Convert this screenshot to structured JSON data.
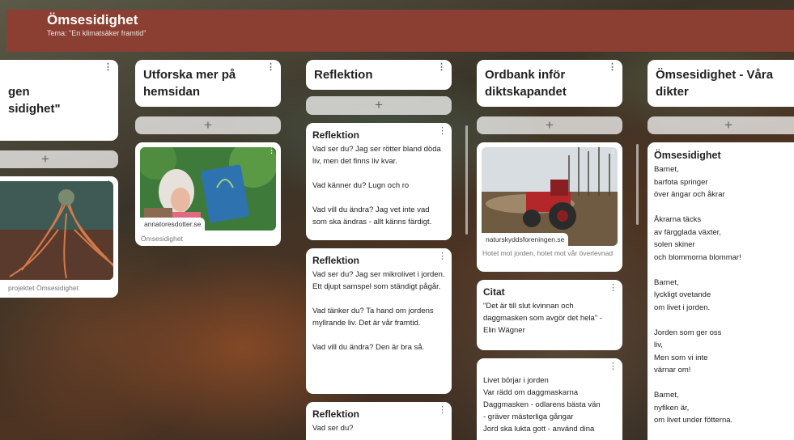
{
  "header": {
    "title": "Ömsesidighet",
    "subtitle": "Tema: \"En klimatsäker framtid\""
  },
  "columns": [
    {
      "title": "gen\nsidighet\"",
      "add_label": "+",
      "cards": [
        {
          "caption": "projektet Ömsesidighet",
          "image_icon": "roots-artwork-image"
        }
      ]
    },
    {
      "title": "Utforska mer på hemsidan",
      "add_label": "+",
      "cards": [
        {
          "link_label": "annatoresdotter.se",
          "caption": "Ömsesidighet",
          "image_icon": "woman-painting-photo"
        }
      ]
    },
    {
      "title": "Reflektion",
      "add_label": "+",
      "cards": [
        {
          "title": "Reflektion",
          "body": "Vad ser du? Jag ser rötter bland döda liv, men det finns liv kvar.\n\nVad känner du? Lugn och ro\n\nVad vill du ändra? Jag vet inte vad som ska ändras - allt känns färdigt."
        },
        {
          "title": "Reflektion",
          "body": "Vad ser du? Jag ser mikrolivet i jorden. Ett djupt samspel som ständigt pågår.\n\nVad tänker du? Ta hand om jordens myllrande liv. Det är vår framtid.\n\nVad vill du ändra? Den är bra så."
        },
        {
          "title": "Reflektion",
          "body": "Vad ser du?"
        }
      ]
    },
    {
      "title": "Ordbank inför diktskapandet",
      "add_label": "+",
      "cards": [
        {
          "link_label": "naturskyddsforeningen.se",
          "caption": "Hotet mot jorden, hotet mot vår överlevnad",
          "image_icon": "tractor-field-photo"
        },
        {
          "title": "Citat",
          "body": "\"Det är till slut kvinnan och daggmasken som avgör det hela\" - Elin Wägner"
        },
        {
          "body": "Livet börjar i jorden\nVar rädd om daggmaskarna\nDaggmasken - odlarens bästa vän\n- gräver mästerliga gångar\nJord ska lukta gott - använd dina"
        }
      ]
    },
    {
      "title": "Ömsesidighet - Våra dikter",
      "add_label": "+",
      "cards": [
        {
          "title": "Ömsesidighet",
          "body": "Barnet,\nbarfota springer\növer ängar och åkrar\n\nÅkrarna täcks\nav färgglada växter,\nsolen skiner\noch blommorna blommar!\n\nBarnet,\nlyckligt ovetande\nom livet i jorden.\n\nJorden som ger oss\nliv,\nMen som vi inte\nvärnar om!\n\nBarnet,\nnyfiken är,\nom livet under fötterna."
        }
      ]
    }
  ],
  "icons": {
    "more": "⋮",
    "add": "+"
  },
  "colors": {
    "header": "#8b3f32"
  }
}
